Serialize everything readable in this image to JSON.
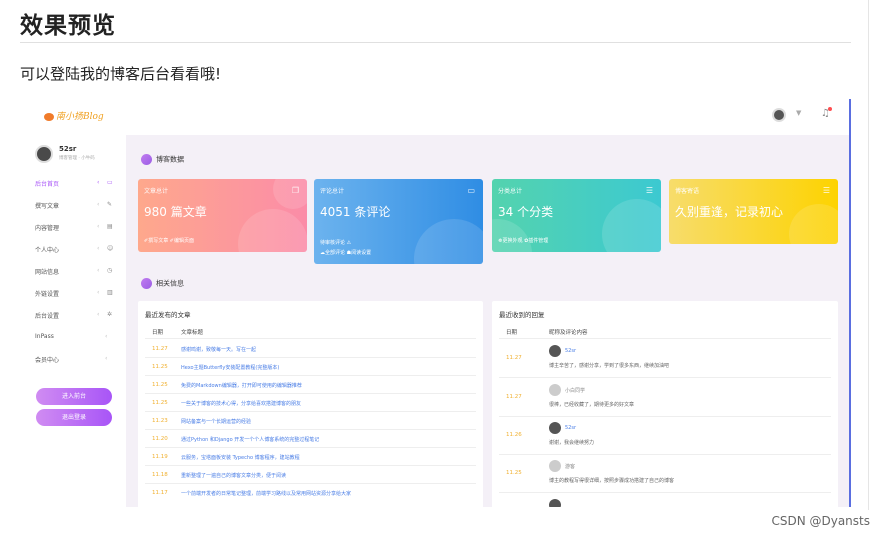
{
  "article": {
    "heading": "效果预览",
    "paragraph": "可以登陆我的博客后台看看哦!",
    "watermark": "CSDN @Dyansts"
  },
  "topbar": {
    "logo_text": "南小扬Blog"
  },
  "sidebar": {
    "username": "52sr",
    "user_sub": "博客管理 · 小牛码",
    "items": [
      {
        "label": "后台首页",
        "icon": "monitor-icon",
        "active": true
      },
      {
        "label": "撰写文章",
        "icon": "pencil-icon",
        "active": false
      },
      {
        "label": "内容管理",
        "icon": "file-icon",
        "active": false
      },
      {
        "label": "个人中心",
        "icon": "user-icon",
        "active": false
      },
      {
        "label": "网站信息",
        "icon": "info-icon",
        "active": false
      },
      {
        "label": "外链设置",
        "icon": "folder-icon",
        "active": false
      },
      {
        "label": "后台设置",
        "icon": "gear-icon",
        "active": false
      },
      {
        "label": "InPass",
        "icon": "",
        "active": false
      },
      {
        "label": "会员中心",
        "icon": "",
        "active": false
      }
    ],
    "btn_enter": "进入前台",
    "btn_logout": "退出登录"
  },
  "sections": {
    "stats_title": "博客数据",
    "related_title": "相关信息"
  },
  "cards": [
    {
      "title": "文章总计",
      "value": "980 篇文章",
      "sub": "✐撰写文章 ✐编辑页面"
    },
    {
      "title": "评论总计",
      "value": "4051 条评论",
      "extra": "待审核评论 ⚠",
      "sub": "☁全部评论  ☗阅读设置"
    },
    {
      "title": "分类总计",
      "value": "34 个分类",
      "sub": "☸更换外观 ✿插件管理"
    },
    {
      "title": "博客寄语",
      "value": "久别重逢，记录初心",
      "sub": ""
    }
  ],
  "recent_posts": {
    "title": "最近发布的文章",
    "col_date": "日期",
    "col_title": "文章标题",
    "rows": [
      {
        "date": "11.27",
        "title": "感谢鸣谢，致敬每一天。写在一起"
      },
      {
        "date": "11.25",
        "title": "Hexo主题Butterfly安装配置教程(完整版本)"
      },
      {
        "date": "11.25",
        "title": "免费的Markdown编辑器，打开即可使用的编辑器推荐"
      },
      {
        "date": "11.25",
        "title": "一些关于博客的技术心得，分享给喜欢搭建博客的朋友"
      },
      {
        "date": "11.23",
        "title": "网站备案与一个长期运营的经验"
      },
      {
        "date": "11.20",
        "title": "通过Python 和Django 开发一个个人博客系统的完整过程笔记"
      },
      {
        "date": "11.19",
        "title": "云服务，宝塔面板安装 Typecho 博客程序，建站教程"
      },
      {
        "date": "11.18",
        "title": "重新整理了一遍自己的博客文章分类，便于阅读"
      },
      {
        "date": "11.17",
        "title": "一个前端开发者的日常笔记整理，前端学习路线以及常用网站资源分享给大家"
      }
    ]
  },
  "recent_comments": {
    "title": "最近收到的回复",
    "col_date": "日期",
    "col_content": "昵称及评论内容",
    "rows": [
      {
        "date": "11.27",
        "name": "52sr",
        "text": "博主辛苦了，感谢分享，学到了很多东西，继续加油吧",
        "avatar": "dark"
      },
      {
        "date": "11.27",
        "name": "小白同学",
        "text": "很棒，已经收藏了，期待更多的好文章",
        "avatar": "light"
      },
      {
        "date": "11.26",
        "name": "52sr",
        "text": "谢谢，我会继续努力",
        "avatar": "dark"
      },
      {
        "date": "11.25",
        "name": "游客",
        "text": "博主的教程写得很详细，按照步骤成功搭建了自己的博客",
        "avatar": "light"
      }
    ]
  }
}
